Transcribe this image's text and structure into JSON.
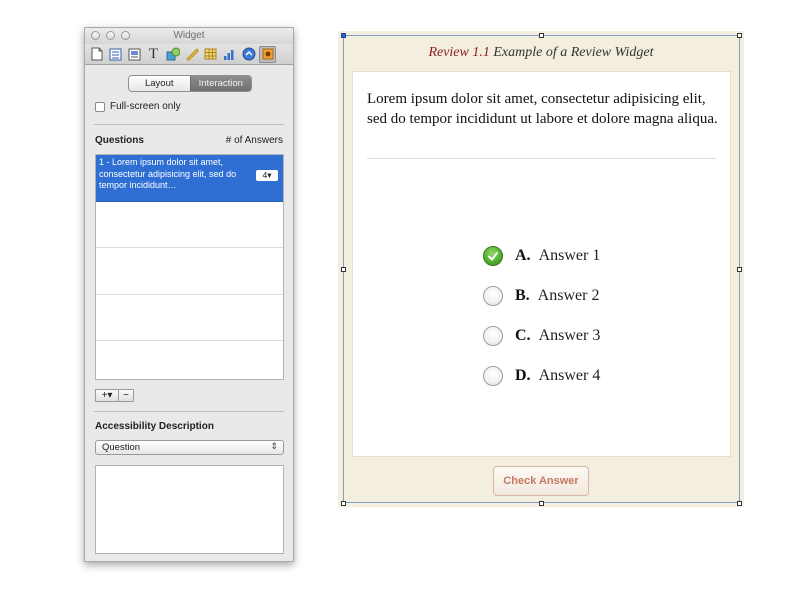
{
  "inspector": {
    "title": "Widget",
    "toolbar_icons": [
      "document-icon",
      "metrics-icon",
      "wrap-icon",
      "text-icon",
      "graphic-icon",
      "ruler-icon",
      "table-icon",
      "chart-icon",
      "link-icon",
      "widget-icon"
    ],
    "tabs": {
      "layout": "Layout",
      "interaction": "Interaction",
      "active": "Interaction"
    },
    "fullscreen_label": "Full-screen only",
    "questions_label": "Questions",
    "answers_label": "# of Answers",
    "questions": [
      {
        "text": "1 - Lorem ipsum dolor sit amet, consectetur adipisicing elit, sed do tempor incididunt…",
        "answers": "4▾"
      }
    ],
    "add_label": "+▾",
    "remove_label": "−",
    "accessibility_label": "Accessibility Description",
    "accessibility_value": "Question",
    "accessibility_arrow": "⇕"
  },
  "widget": {
    "review_label": "Review 1.1",
    "review_title": "Example of a Review Widget",
    "question": "Lorem ipsum dolor sit amet, consectetur adipisicing elit, sed do tempor incididunt ut labore et dolore magna aliqua.",
    "answers": [
      {
        "letter": "A.",
        "text": "Answer 1",
        "selected": true
      },
      {
        "letter": "B.",
        "text": "Answer 2",
        "selected": false
      },
      {
        "letter": "C.",
        "text": "Answer 3",
        "selected": false
      },
      {
        "letter": "D.",
        "text": "Answer 4",
        "selected": false
      }
    ],
    "check_button": "Check Answer"
  },
  "colors": {
    "accent_blue": "#2f6fd4",
    "correct_green": "#4fae2c",
    "review_red": "#8a1c1c",
    "widget_bg": "#f3eedd"
  }
}
